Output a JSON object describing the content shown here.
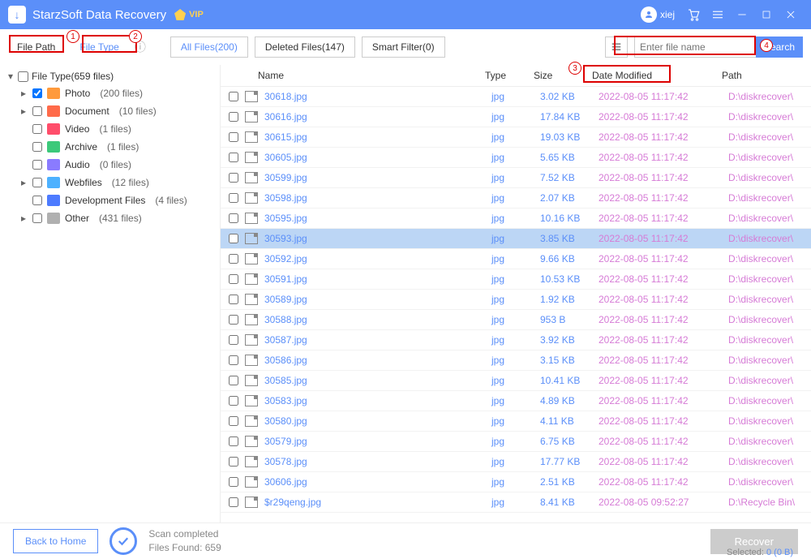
{
  "titlebar": {
    "app_name": "StarzSoft Data Recovery",
    "vip_label": "VIP",
    "user_name": "xiej"
  },
  "toolbar": {
    "tab_file_path": "File Path",
    "tab_file_type": "File Type",
    "filter_all": "All Files(200)",
    "filter_deleted": "Deleted Files(147)",
    "filter_smart": "Smart Filter(0)",
    "search_placeholder": "Enter file name",
    "search_button": "Search"
  },
  "annotations": {
    "n1": "1",
    "n2": "2",
    "n3": "3",
    "n4": "4"
  },
  "sidebar": {
    "root_label": "File Type(659 files)",
    "items": [
      {
        "icon": "ic-photo",
        "name": "Photo",
        "count": "(200 files)",
        "arrow": "▸",
        "checked": true
      },
      {
        "icon": "ic-doc",
        "name": "Document",
        "count": "(10 files)",
        "arrow": "▸",
        "checked": false
      },
      {
        "icon": "ic-video",
        "name": "Video",
        "count": "(1 files)",
        "arrow": "",
        "checked": false
      },
      {
        "icon": "ic-archive",
        "name": "Archive",
        "count": "(1 files)",
        "arrow": "",
        "checked": false
      },
      {
        "icon": "ic-audio",
        "name": "Audio",
        "count": "(0 files)",
        "arrow": "",
        "checked": false
      },
      {
        "icon": "ic-web",
        "name": "Webfiles",
        "count": "(12 files)",
        "arrow": "▸",
        "checked": false
      },
      {
        "icon": "ic-dev",
        "name": "Development Files",
        "count": "(4 files)",
        "arrow": "",
        "checked": false
      },
      {
        "icon": "ic-other",
        "name": "Other",
        "count": "(431 files)",
        "arrow": "▸",
        "checked": false
      }
    ]
  },
  "table": {
    "headers": {
      "name": "Name",
      "type": "Type",
      "size": "Size",
      "date": "Date Modified",
      "path": "Path"
    },
    "rows": [
      {
        "name": "30618.jpg",
        "type": "jpg",
        "size": "3.02 KB",
        "date": "2022-08-05 11:17:42",
        "path": "D:\\diskrecover\\",
        "selected": false
      },
      {
        "name": "30616.jpg",
        "type": "jpg",
        "size": "17.84 KB",
        "date": "2022-08-05 11:17:42",
        "path": "D:\\diskrecover\\",
        "selected": false
      },
      {
        "name": "30615.jpg",
        "type": "jpg",
        "size": "19.03 KB",
        "date": "2022-08-05 11:17:42",
        "path": "D:\\diskrecover\\",
        "selected": false
      },
      {
        "name": "30605.jpg",
        "type": "jpg",
        "size": "5.65 KB",
        "date": "2022-08-05 11:17:42",
        "path": "D:\\diskrecover\\",
        "selected": false
      },
      {
        "name": "30599.jpg",
        "type": "jpg",
        "size": "7.52 KB",
        "date": "2022-08-05 11:17:42",
        "path": "D:\\diskrecover\\",
        "selected": false
      },
      {
        "name": "30598.jpg",
        "type": "jpg",
        "size": "2.07 KB",
        "date": "2022-08-05 11:17:42",
        "path": "D:\\diskrecover\\",
        "selected": false
      },
      {
        "name": "30595.jpg",
        "type": "jpg",
        "size": "10.16 KB",
        "date": "2022-08-05 11:17:42",
        "path": "D:\\diskrecover\\",
        "selected": false
      },
      {
        "name": "30593.jpg",
        "type": "jpg",
        "size": "3.85 KB",
        "date": "2022-08-05 11:17:42",
        "path": "D:\\diskrecover\\",
        "selected": true
      },
      {
        "name": "30592.jpg",
        "type": "jpg",
        "size": "9.66 KB",
        "date": "2022-08-05 11:17:42",
        "path": "D:\\diskrecover\\",
        "selected": false
      },
      {
        "name": "30591.jpg",
        "type": "jpg",
        "size": "10.53 KB",
        "date": "2022-08-05 11:17:42",
        "path": "D:\\diskrecover\\",
        "selected": false
      },
      {
        "name": "30589.jpg",
        "type": "jpg",
        "size": "1.92 KB",
        "date": "2022-08-05 11:17:42",
        "path": "D:\\diskrecover\\",
        "selected": false
      },
      {
        "name": "30588.jpg",
        "type": "jpg",
        "size": "953 B",
        "date": "2022-08-05 11:17:42",
        "path": "D:\\diskrecover\\",
        "selected": false
      },
      {
        "name": "30587.jpg",
        "type": "jpg",
        "size": "3.92 KB",
        "date": "2022-08-05 11:17:42",
        "path": "D:\\diskrecover\\",
        "selected": false
      },
      {
        "name": "30586.jpg",
        "type": "jpg",
        "size": "3.15 KB",
        "date": "2022-08-05 11:17:42",
        "path": "D:\\diskrecover\\",
        "selected": false
      },
      {
        "name": "30585.jpg",
        "type": "jpg",
        "size": "10.41 KB",
        "date": "2022-08-05 11:17:42",
        "path": "D:\\diskrecover\\",
        "selected": false
      },
      {
        "name": "30583.jpg",
        "type": "jpg",
        "size": "4.89 KB",
        "date": "2022-08-05 11:17:42",
        "path": "D:\\diskrecover\\",
        "selected": false
      },
      {
        "name": "30580.jpg",
        "type": "jpg",
        "size": "4.11 KB",
        "date": "2022-08-05 11:17:42",
        "path": "D:\\diskrecover\\",
        "selected": false
      },
      {
        "name": "30579.jpg",
        "type": "jpg",
        "size": "6.75 KB",
        "date": "2022-08-05 11:17:42",
        "path": "D:\\diskrecover\\",
        "selected": false
      },
      {
        "name": "30578.jpg",
        "type": "jpg",
        "size": "17.77 KB",
        "date": "2022-08-05 11:17:42",
        "path": "D:\\diskrecover\\",
        "selected": false
      },
      {
        "name": "30606.jpg",
        "type": "jpg",
        "size": "2.51 KB",
        "date": "2022-08-05 11:17:42",
        "path": "D:\\diskrecover\\",
        "selected": false
      },
      {
        "name": "$r29qeng.jpg",
        "type": "jpg",
        "size": "8.41 KB",
        "date": "2022-08-05 09:52:27",
        "path": "D:\\Recycle Bin\\",
        "selected": false
      }
    ]
  },
  "footer": {
    "back_label": "Back to Home",
    "status_line1": "Scan completed",
    "status_line2": "Files Found: 659",
    "recover_label": "Recover",
    "selected_label": "Selected:",
    "selected_value": "0 (0 B)"
  }
}
